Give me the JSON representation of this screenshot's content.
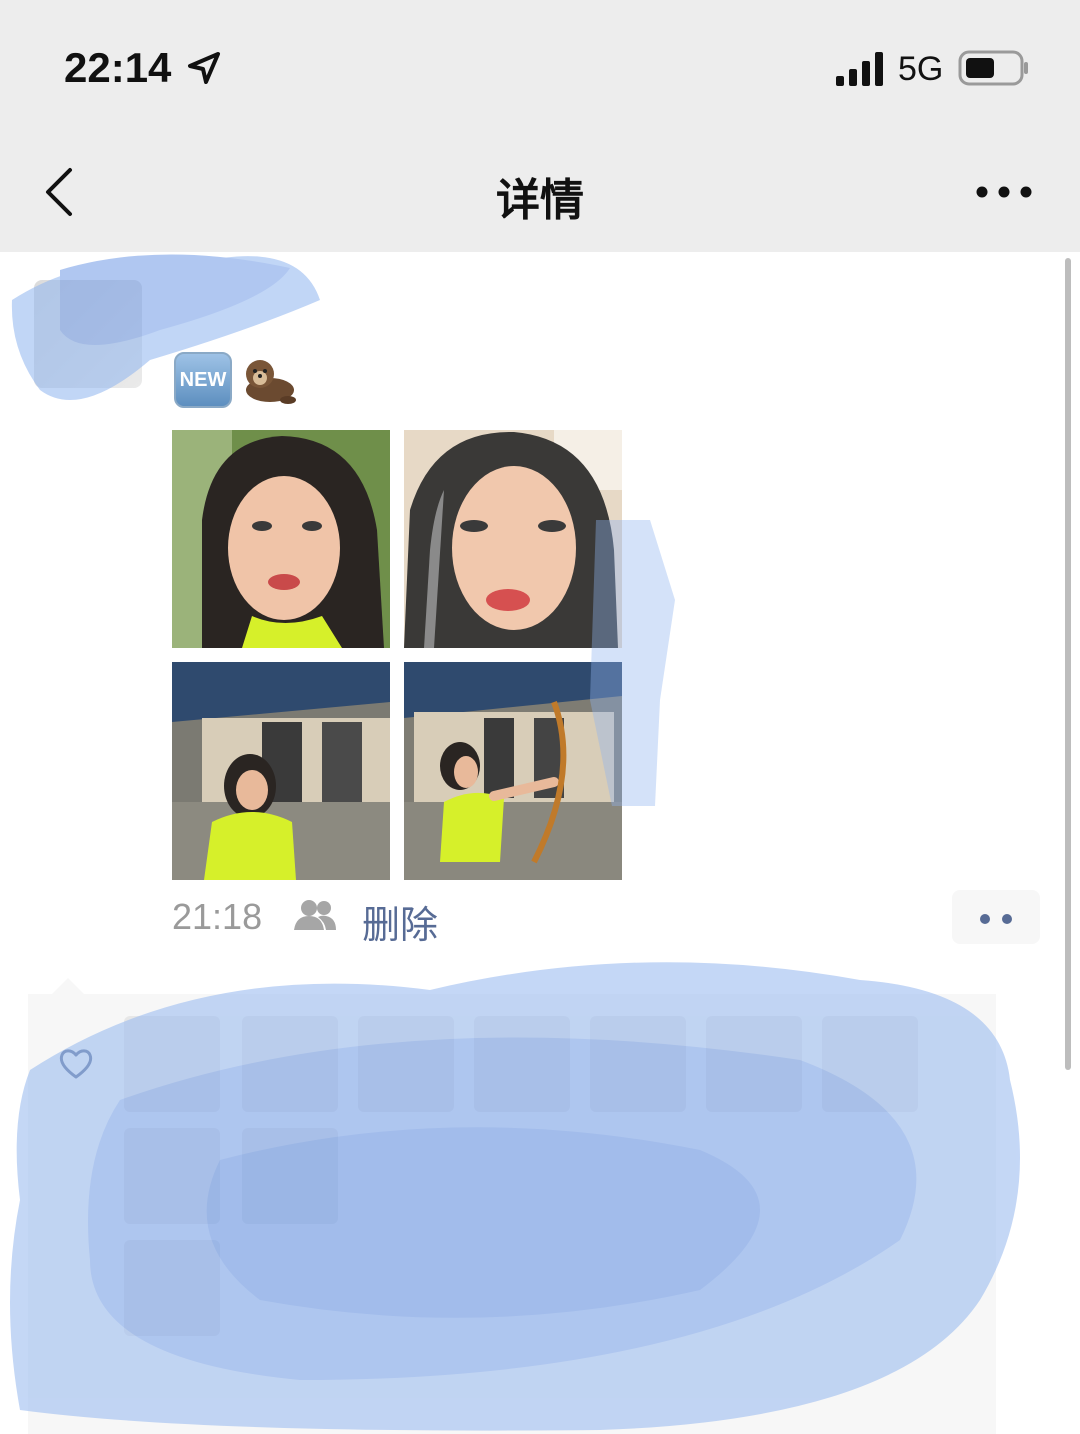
{
  "status_bar": {
    "time": "22:14",
    "network": "5G"
  },
  "nav": {
    "title": "详情"
  },
  "post": {
    "badge": "NEW",
    "emoji_icon": "otter-emoji",
    "photos": [
      "selfie-1",
      "selfie-2",
      "archery-1",
      "archery-2"
    ],
    "time": "21:18",
    "delete_label": "删除"
  },
  "colors": {
    "link": "#576b95",
    "bar_bg": "#ededed",
    "panel_bg": "#f7f7f7"
  }
}
